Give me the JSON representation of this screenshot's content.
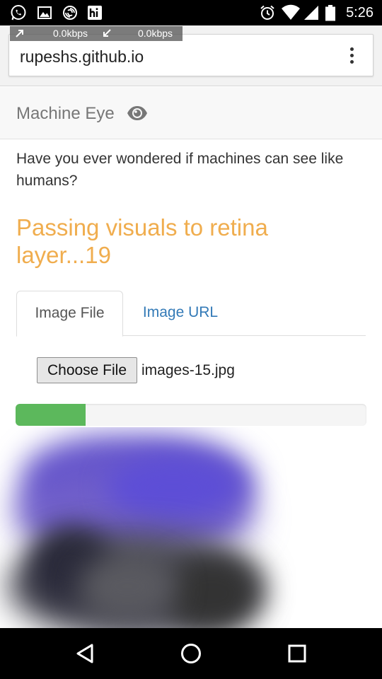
{
  "status_bar": {
    "time": "5:26",
    "left_icons": [
      "whatsapp-icon",
      "gallery-icon",
      "swirl-app-icon",
      "hi-app-icon"
    ],
    "right_icons": [
      "alarm-icon",
      "wifi-icon",
      "signal-icon",
      "battery-icon"
    ]
  },
  "browser": {
    "url": "rupeshs.github.io",
    "speed_up": "0.0kbps",
    "speed_down": "0.0kbps",
    "menu_icon": "more-vert-icon"
  },
  "navbar": {
    "brand": "Machine Eye",
    "brand_icon": "eye-icon"
  },
  "content": {
    "intro": "Have you ever wondered if machines can see like humans?",
    "status_message": "Passing visuals to retina layer...19",
    "tabs": [
      {
        "label": "Image File",
        "active": true
      },
      {
        "label": "Image URL",
        "active": false
      }
    ],
    "file_input": {
      "button_label": "Choose File",
      "file_name": "images-15.jpg"
    },
    "progress_percent": 20
  },
  "colors": {
    "status_text": "#f0ad4e",
    "progress": "#5cb85c",
    "link": "#337ab7"
  },
  "nav_buttons": [
    "back-icon",
    "home-icon",
    "recents-icon"
  ]
}
